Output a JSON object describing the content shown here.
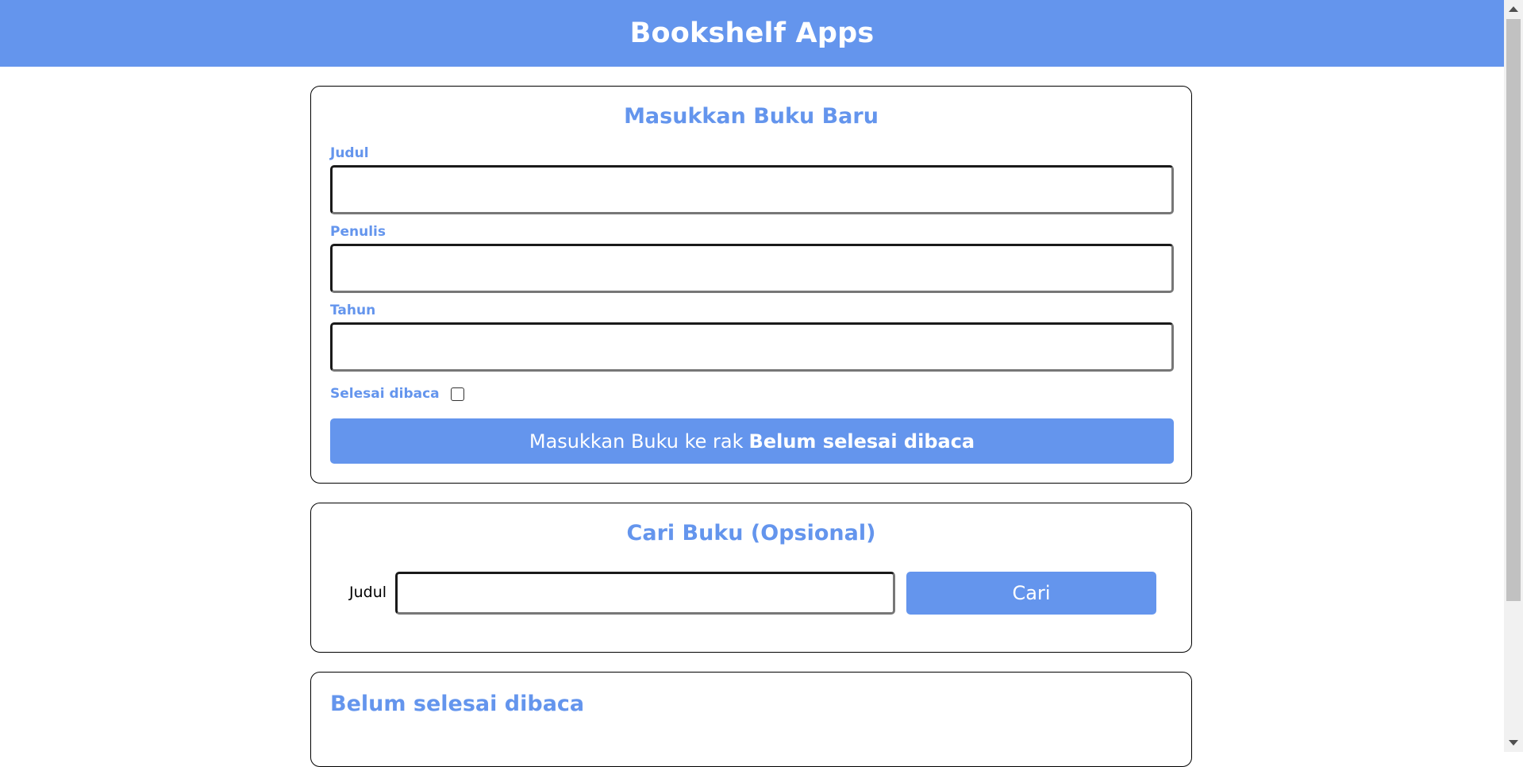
{
  "header": {
    "title": "Bookshelf Apps"
  },
  "input_section": {
    "title": "Masukkan Buku Baru",
    "title_label": "Judul",
    "author_label": "Penulis",
    "year_label": "Tahun",
    "title_value": "",
    "author_value": "",
    "year_value": "",
    "complete_label": "Selesai dibaca",
    "complete_checked": false,
    "submit_prefix": "Masukkan Buku ke rak",
    "submit_shelf": "Belum selesai dibaca"
  },
  "search_section": {
    "title": "Cari Buku (Opsional)",
    "label": "Judul",
    "value": "",
    "button": "Cari"
  },
  "incomplete_shelf": {
    "title": "Belum selesai dibaca"
  },
  "colors": {
    "accent": "#6495ed",
    "background": "#ffffff",
    "border": "#000000"
  }
}
